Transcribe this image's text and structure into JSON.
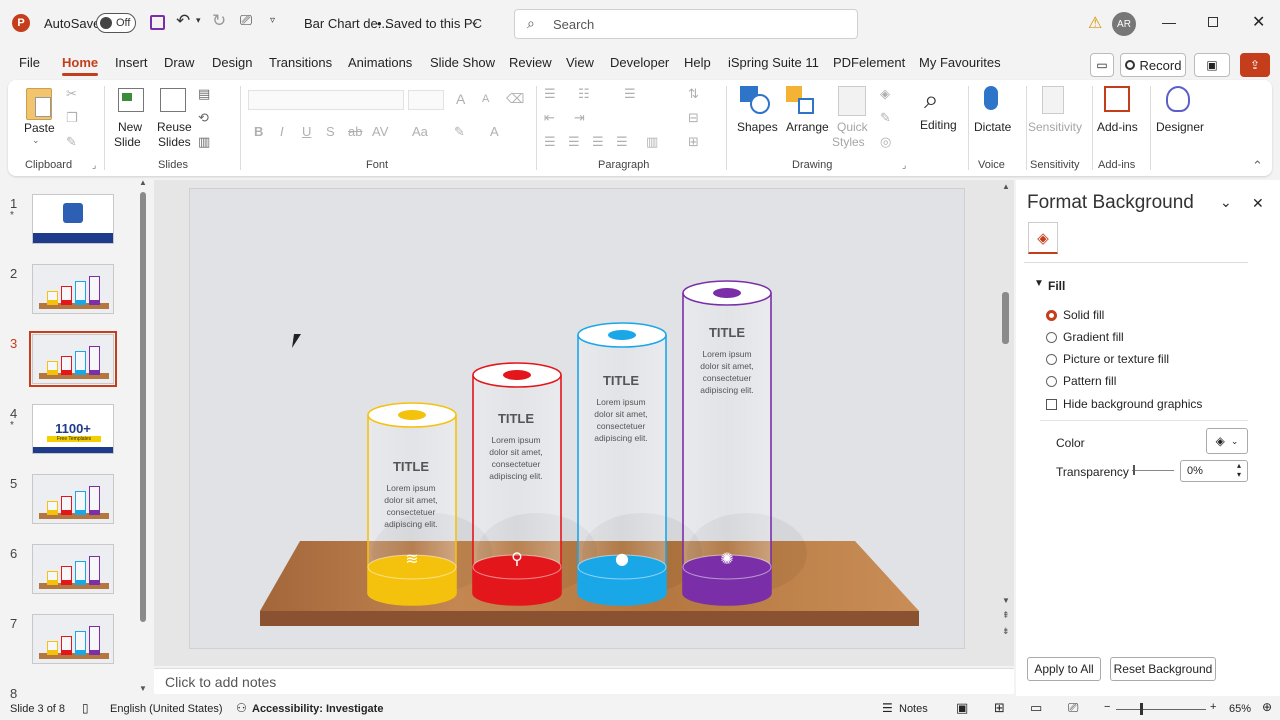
{
  "titlebar": {
    "autosave_label": "AutoSave",
    "autosave_state": "Off",
    "doc_title": "Bar Chart de...",
    "save_state": "• Saved to this PC",
    "search_placeholder": "Search",
    "user_initials": "AR"
  },
  "menu": {
    "tabs": [
      "File",
      "Home",
      "Insert",
      "Draw",
      "Design",
      "Transitions",
      "Animations",
      "Slide Show",
      "Review",
      "View",
      "Developer",
      "Help",
      "iSpring Suite 11",
      "PDFelement",
      "My Favourites"
    ],
    "active": "Home",
    "record_label": "Record"
  },
  "ribbon": {
    "clipboard": {
      "paste": "Paste",
      "label": "Clipboard"
    },
    "slides": {
      "new_slide": "New",
      "new_slide2": "Slide",
      "reuse": "Reuse",
      "reuse2": "Slides",
      "label": "Slides"
    },
    "font": {
      "label": "Font",
      "bold": "B",
      "italic": "I",
      "underline": "U",
      "strike": "S",
      "abc": "ab",
      "spacing": "AV",
      "case": "Aa",
      "size_up": "A",
      "size_down": "A"
    },
    "paragraph": {
      "label": "Paragraph"
    },
    "drawing": {
      "shapes": "Shapes",
      "arrange": "Arrange",
      "quick": "Quick",
      "quick2": "Styles",
      "label": "Drawing"
    },
    "editing": {
      "label": "Editing"
    },
    "voice": {
      "dictate": "Dictate",
      "label": "Voice"
    },
    "sensitivity": {
      "btn": "Sensitivity",
      "label": "Sensitivity"
    },
    "addins": {
      "btn": "Add-ins",
      "label": "Add-ins"
    },
    "designer": {
      "btn": "Designer"
    }
  },
  "thumbnails": [
    {
      "num": "1",
      "star": true
    },
    {
      "num": "2",
      "star": false
    },
    {
      "num": "3",
      "star": false,
      "selected": true
    },
    {
      "num": "4",
      "star": true,
      "text1": "1100+",
      "text2": "Free Templates"
    },
    {
      "num": "5",
      "star": false
    },
    {
      "num": "6",
      "star": false
    },
    {
      "num": "7",
      "star": false
    },
    {
      "num": "8",
      "star": false
    }
  ],
  "slide": {
    "cylinders": [
      {
        "title": "TITLE",
        "body": [
          "Lorem ipsum",
          "dolor sit amet,",
          "consectetuer",
          "adipiscing elit."
        ],
        "color": "#f4c20d",
        "icon": "books-icon"
      },
      {
        "title": "TITLE",
        "body": [
          "Lorem ipsum",
          "dolor sit amet,",
          "consectetuer",
          "adipiscing elit."
        ],
        "color": "#e3161c",
        "icon": "cyclist-icon"
      },
      {
        "title": "TITLE",
        "body": [
          "Lorem ipsum",
          "dolor sit amet,",
          "consectetuer",
          "adipiscing elit."
        ],
        "color": "#1aa7e8",
        "icon": "apple-icon"
      },
      {
        "title": "TITLE",
        "body": [
          "Lorem ipsum",
          "dolor sit amet,",
          "consectetuer",
          "adipiscing elit."
        ],
        "color": "#7a2fa8",
        "icon": "aperture-icon"
      }
    ]
  },
  "notes_placeholder": "Click to add notes",
  "status": {
    "slide_info": "Slide 3 of 8",
    "language": "English (United States)",
    "accessibility": "Accessibility: Investigate",
    "notes": "Notes",
    "zoom": "65%"
  },
  "pane": {
    "title": "Format Background",
    "section": "Fill",
    "options": [
      "Solid fill",
      "Gradient fill",
      "Picture or texture fill",
      "Pattern fill"
    ],
    "selected": "Solid fill",
    "hide_graphics": "Hide background graphics",
    "color_label": "Color",
    "transparency_label": "Transparency",
    "transparency_value": "0%",
    "apply_all": "Apply to All",
    "reset": "Reset Background"
  },
  "colors": {
    "accent": "#c43e1c"
  }
}
